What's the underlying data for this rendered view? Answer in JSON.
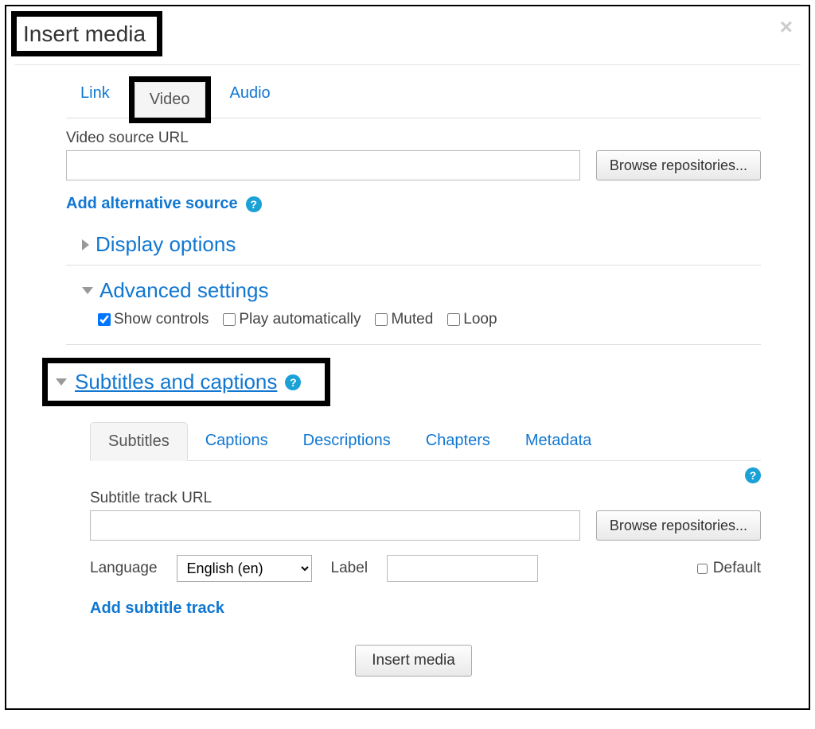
{
  "dialog": {
    "title": "Insert media",
    "close_label": "×"
  },
  "top_tabs": {
    "link": "Link",
    "video": "Video",
    "audio": "Audio"
  },
  "video": {
    "source_label": "Video source URL",
    "source_value": "",
    "browse_label": "Browse repositories...",
    "add_alt_label": "Add alternative source"
  },
  "sections": {
    "display_options": "Display options",
    "advanced_settings": "Advanced settings",
    "subtitles_captions": "Subtitles and captions"
  },
  "advanced": {
    "show_controls": "Show controls",
    "play_auto": "Play automatically",
    "muted": "Muted",
    "loop": "Loop"
  },
  "sub_tabs": {
    "subtitles": "Subtitles",
    "captions": "Captions",
    "descriptions": "Descriptions",
    "chapters": "Chapters",
    "metadata": "Metadata"
  },
  "subtitle_panel": {
    "track_url_label": "Subtitle track URL",
    "track_url_value": "",
    "browse_label": "Browse repositories...",
    "language_label": "Language",
    "language_value": "English (en)",
    "label_label": "Label",
    "label_value": "",
    "default_label": "Default",
    "add_track_label": "Add subtitle track"
  },
  "footer": {
    "insert_label": "Insert media"
  }
}
